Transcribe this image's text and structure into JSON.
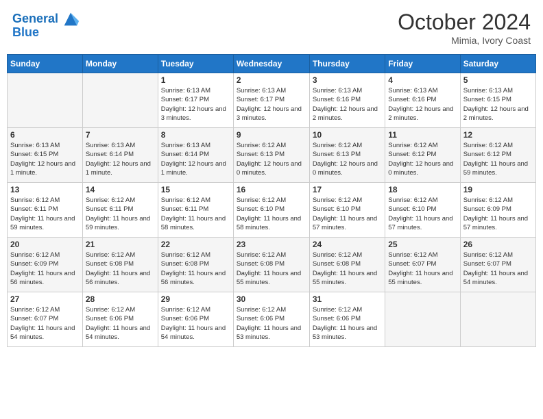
{
  "header": {
    "logo_line1": "General",
    "logo_line2": "Blue",
    "month": "October 2024",
    "location": "Mimia, Ivory Coast"
  },
  "weekdays": [
    "Sunday",
    "Monday",
    "Tuesday",
    "Wednesday",
    "Thursday",
    "Friday",
    "Saturday"
  ],
  "weeks": [
    [
      {
        "day": "",
        "info": ""
      },
      {
        "day": "",
        "info": ""
      },
      {
        "day": "1",
        "info": "Sunrise: 6:13 AM\nSunset: 6:17 PM\nDaylight: 12 hours and 3 minutes."
      },
      {
        "day": "2",
        "info": "Sunrise: 6:13 AM\nSunset: 6:17 PM\nDaylight: 12 hours and 3 minutes."
      },
      {
        "day": "3",
        "info": "Sunrise: 6:13 AM\nSunset: 6:16 PM\nDaylight: 12 hours and 2 minutes."
      },
      {
        "day": "4",
        "info": "Sunrise: 6:13 AM\nSunset: 6:16 PM\nDaylight: 12 hours and 2 minutes."
      },
      {
        "day": "5",
        "info": "Sunrise: 6:13 AM\nSunset: 6:15 PM\nDaylight: 12 hours and 2 minutes."
      }
    ],
    [
      {
        "day": "6",
        "info": "Sunrise: 6:13 AM\nSunset: 6:15 PM\nDaylight: 12 hours and 1 minute."
      },
      {
        "day": "7",
        "info": "Sunrise: 6:13 AM\nSunset: 6:14 PM\nDaylight: 12 hours and 1 minute."
      },
      {
        "day": "8",
        "info": "Sunrise: 6:13 AM\nSunset: 6:14 PM\nDaylight: 12 hours and 1 minute."
      },
      {
        "day": "9",
        "info": "Sunrise: 6:12 AM\nSunset: 6:13 PM\nDaylight: 12 hours and 0 minutes."
      },
      {
        "day": "10",
        "info": "Sunrise: 6:12 AM\nSunset: 6:13 PM\nDaylight: 12 hours and 0 minutes."
      },
      {
        "day": "11",
        "info": "Sunrise: 6:12 AM\nSunset: 6:12 PM\nDaylight: 12 hours and 0 minutes."
      },
      {
        "day": "12",
        "info": "Sunrise: 6:12 AM\nSunset: 6:12 PM\nDaylight: 11 hours and 59 minutes."
      }
    ],
    [
      {
        "day": "13",
        "info": "Sunrise: 6:12 AM\nSunset: 6:11 PM\nDaylight: 11 hours and 59 minutes."
      },
      {
        "day": "14",
        "info": "Sunrise: 6:12 AM\nSunset: 6:11 PM\nDaylight: 11 hours and 59 minutes."
      },
      {
        "day": "15",
        "info": "Sunrise: 6:12 AM\nSunset: 6:11 PM\nDaylight: 11 hours and 58 minutes."
      },
      {
        "day": "16",
        "info": "Sunrise: 6:12 AM\nSunset: 6:10 PM\nDaylight: 11 hours and 58 minutes."
      },
      {
        "day": "17",
        "info": "Sunrise: 6:12 AM\nSunset: 6:10 PM\nDaylight: 11 hours and 57 minutes."
      },
      {
        "day": "18",
        "info": "Sunrise: 6:12 AM\nSunset: 6:10 PM\nDaylight: 11 hours and 57 minutes."
      },
      {
        "day": "19",
        "info": "Sunrise: 6:12 AM\nSunset: 6:09 PM\nDaylight: 11 hours and 57 minutes."
      }
    ],
    [
      {
        "day": "20",
        "info": "Sunrise: 6:12 AM\nSunset: 6:09 PM\nDaylight: 11 hours and 56 minutes."
      },
      {
        "day": "21",
        "info": "Sunrise: 6:12 AM\nSunset: 6:08 PM\nDaylight: 11 hours and 56 minutes."
      },
      {
        "day": "22",
        "info": "Sunrise: 6:12 AM\nSunset: 6:08 PM\nDaylight: 11 hours and 56 minutes."
      },
      {
        "day": "23",
        "info": "Sunrise: 6:12 AM\nSunset: 6:08 PM\nDaylight: 11 hours and 55 minutes."
      },
      {
        "day": "24",
        "info": "Sunrise: 6:12 AM\nSunset: 6:08 PM\nDaylight: 11 hours and 55 minutes."
      },
      {
        "day": "25",
        "info": "Sunrise: 6:12 AM\nSunset: 6:07 PM\nDaylight: 11 hours and 55 minutes."
      },
      {
        "day": "26",
        "info": "Sunrise: 6:12 AM\nSunset: 6:07 PM\nDaylight: 11 hours and 54 minutes."
      }
    ],
    [
      {
        "day": "27",
        "info": "Sunrise: 6:12 AM\nSunset: 6:07 PM\nDaylight: 11 hours and 54 minutes."
      },
      {
        "day": "28",
        "info": "Sunrise: 6:12 AM\nSunset: 6:06 PM\nDaylight: 11 hours and 54 minutes."
      },
      {
        "day": "29",
        "info": "Sunrise: 6:12 AM\nSunset: 6:06 PM\nDaylight: 11 hours and 54 minutes."
      },
      {
        "day": "30",
        "info": "Sunrise: 6:12 AM\nSunset: 6:06 PM\nDaylight: 11 hours and 53 minutes."
      },
      {
        "day": "31",
        "info": "Sunrise: 6:12 AM\nSunset: 6:06 PM\nDaylight: 11 hours and 53 minutes."
      },
      {
        "day": "",
        "info": ""
      },
      {
        "day": "",
        "info": ""
      }
    ]
  ]
}
